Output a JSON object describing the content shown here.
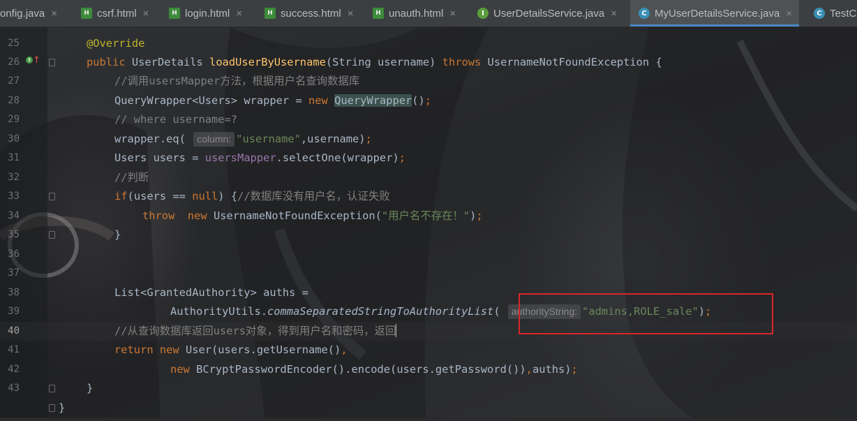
{
  "tabs": [
    {
      "label": "onfig.java",
      "icon": "none",
      "active": false
    },
    {
      "label": "csrf.html",
      "icon": "html-file-icon",
      "active": false
    },
    {
      "label": "login.html",
      "icon": "html-file-icon",
      "active": false
    },
    {
      "label": "success.html",
      "icon": "html-file-icon",
      "active": false
    },
    {
      "label": "unauth.html",
      "icon": "html-file-icon",
      "active": false
    },
    {
      "label": "UserDetailsService.java",
      "icon": "interface-file-icon",
      "active": false
    },
    {
      "label": "MyUserDetailsService.java",
      "icon": "class-file-icon",
      "active": true
    },
    {
      "label": "TestC",
      "icon": "class-file-icon",
      "active": false
    }
  ],
  "icon_glyphs": {
    "html": "H",
    "interface": "I",
    "class": "C",
    "close": "×"
  },
  "lines": {
    "n25": "25",
    "n26": "26",
    "n27": "27",
    "n28": "28",
    "n29": "29",
    "n30": "30",
    "n31": "31",
    "n32": "32",
    "n33": "33",
    "n34": "34",
    "n35": "35",
    "n36": "36",
    "n37": "37",
    "n38": "38",
    "n39": "39",
    "n40": "40",
    "n41": "41",
    "n42": "42",
    "n43": "43"
  },
  "code": {
    "l25": "@Override",
    "l26": {
      "a": "public ",
      "b": "UserDetails ",
      "c": "loadUserByUsername",
      "d": "(String username) ",
      "e": "throws ",
      "f": "UsernameNotFoundException {"
    },
    "l27": "//调用usersMapper方法，根据用户名查询数据库",
    "l28": {
      "a": "QueryWrapper<Users> wrapper = ",
      "b": "new ",
      "c": "QueryWrapper",
      "d": "()",
      "e": ";"
    },
    "l29": "// where username=?",
    "l30": {
      "a": "wrapper.eq( ",
      "hint": "column:",
      "b": "\"username\"",
      "c": ",username)",
      "d": ";"
    },
    "l31": {
      "a": "Users users = ",
      "b": "usersMapper",
      "c": ".selectOne(wrapper)",
      "d": ";"
    },
    "l32": "//判断",
    "l33": {
      "a": "if",
      "b": "(users == ",
      "c": "null",
      "d": ") {",
      "e": "//数据库没有用户名，认证失败"
    },
    "l34": {
      "a": "throw  ",
      "b": "new ",
      "c": "UsernameNotFoundException(",
      "d": "\"用户名不存在！\"",
      "e": ")",
      "f": ";"
    },
    "l35": "}",
    "l38": "List<GrantedAuthority> auths =",
    "l39": {
      "a": "AuthorityUtils.",
      "b": "commaSeparatedStringToAuthorityList",
      "c": "( ",
      "hint": "authorityString:",
      "d": "\"admins,ROLE_sale\"",
      "e": ")",
      "f": ";"
    },
    "l40": "//从查询数据库返回users对象，得到用户名和密码，返回",
    "l41": {
      "a": "return ",
      "b": "new ",
      "c": "User(users.getUsername()",
      "d": ","
    },
    "l42": {
      "a": "new ",
      "b": "BCryptPasswordEncoder().encode(users.getPassword())",
      "c": ",",
      "d": "auths)",
      "e": ";"
    },
    "l43": "}",
    "l44": "}"
  },
  "colors": {
    "keyword": "#cc7832",
    "annotation": "#bbb529",
    "method_decl": "#ffc66d",
    "comment": "#808080",
    "string": "#6a8759",
    "field": "#9876aa",
    "plain": "#a9b7c6",
    "highlight_box": "#d9262a",
    "active_tab_underline": "#4a88c7"
  }
}
